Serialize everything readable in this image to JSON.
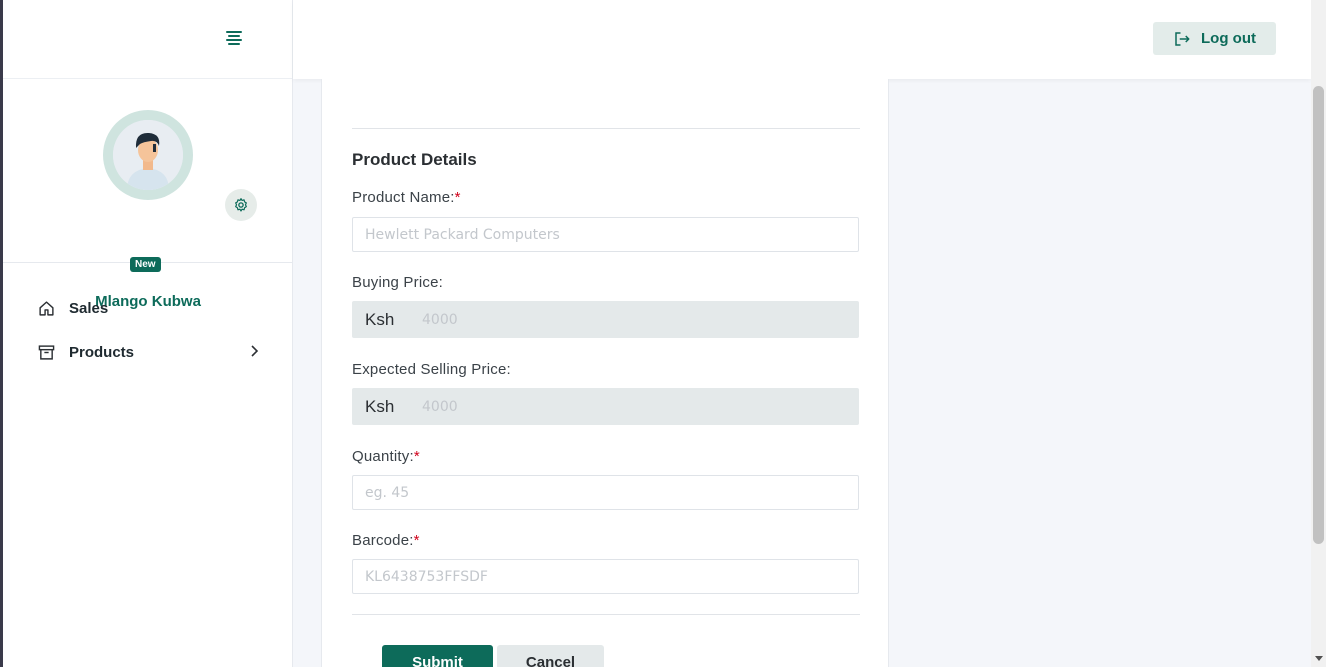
{
  "sidebar": {
    "profile_name": "Mlango Kubwa",
    "badge": "New",
    "nav": [
      {
        "label": "Sales",
        "icon": "home-icon"
      },
      {
        "label": "Products",
        "icon": "archive-icon"
      }
    ]
  },
  "topbar": {
    "logout_label": "Log out"
  },
  "form": {
    "section_title": "Product Details",
    "product_name": {
      "label": "Product Name:",
      "required": "*",
      "placeholder": "Hewlett Packard Computers"
    },
    "buying_price": {
      "label": "Buying Price:",
      "prefix": "Ksh",
      "placeholder": "4000"
    },
    "selling_price": {
      "label": "Expected Selling Price:",
      "prefix": "Ksh",
      "placeholder": "4000"
    },
    "quantity": {
      "label": "Quantity:",
      "required": "*",
      "placeholder": "eg. 45"
    },
    "barcode": {
      "label": "Barcode:",
      "required": "*",
      "placeholder": "KL6438753FFSDF"
    },
    "submit_label": "Submit",
    "cancel_label": "Cancel"
  },
  "colors": {
    "brand": "#0d6b5a",
    "brand_light": "#e3ecea",
    "required": "#d0021b"
  }
}
